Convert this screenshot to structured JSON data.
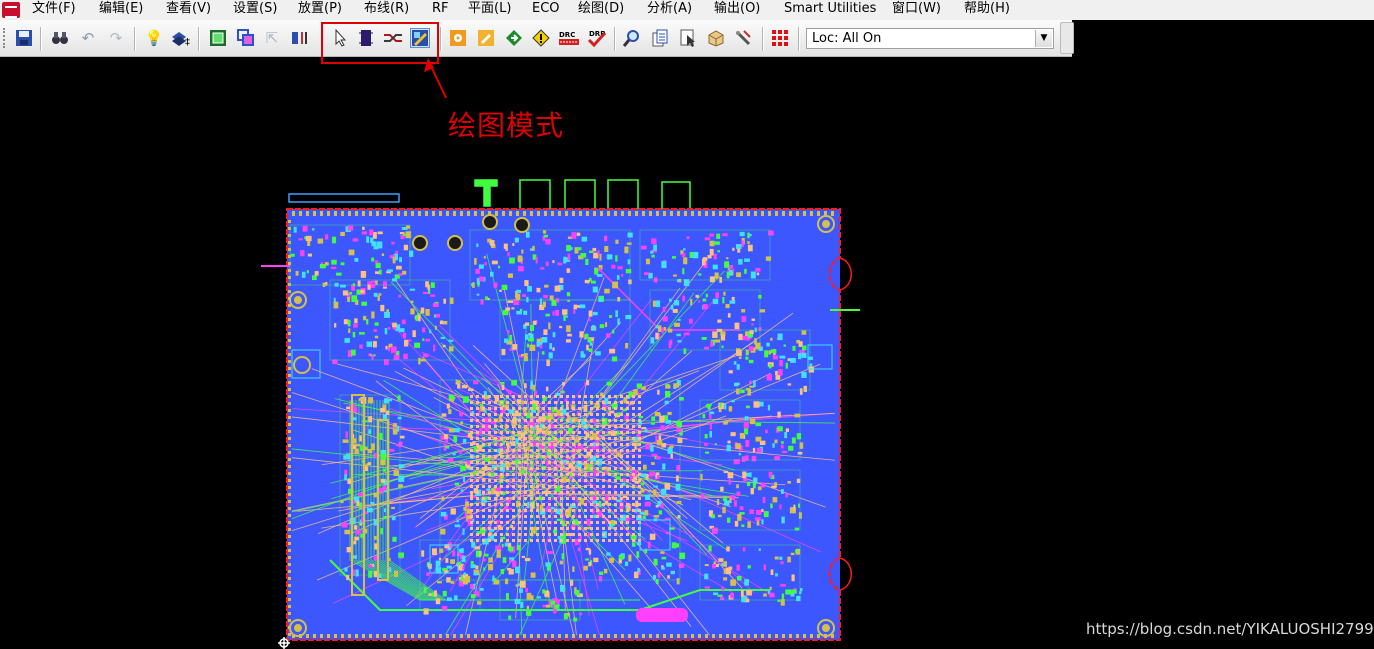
{
  "menubar": {
    "items": [
      "文件(F)",
      "编辑(E)",
      "查看(V)",
      "设置(S)",
      "放置(P)",
      "布线(R)",
      "RF",
      "平面(L)",
      "ECO",
      "绘图(D)",
      "分析(A)",
      "输出(O)",
      "Smart Utilities",
      "窗口(W)",
      "帮助(H)"
    ]
  },
  "toolbar": {
    "location_select": {
      "value": "Loc: All On"
    },
    "drc_label": "DRC",
    "drp_label": "DRP"
  },
  "annotation": {
    "label": "绘图模式",
    "color": "#e00000"
  },
  "colors": {
    "background": "#000000",
    "board_fill": "#3d57ff",
    "outline": "#ff1a1a",
    "pad": "#d4c04a",
    "trace_magenta": "#ff40ff",
    "trace_green": "#40ff40",
    "trace_peach": "#ffc080",
    "trace_cyan": "#40e0ff"
  },
  "watermark": "https://blog.csdn.net/YIKALUOSHI2799"
}
